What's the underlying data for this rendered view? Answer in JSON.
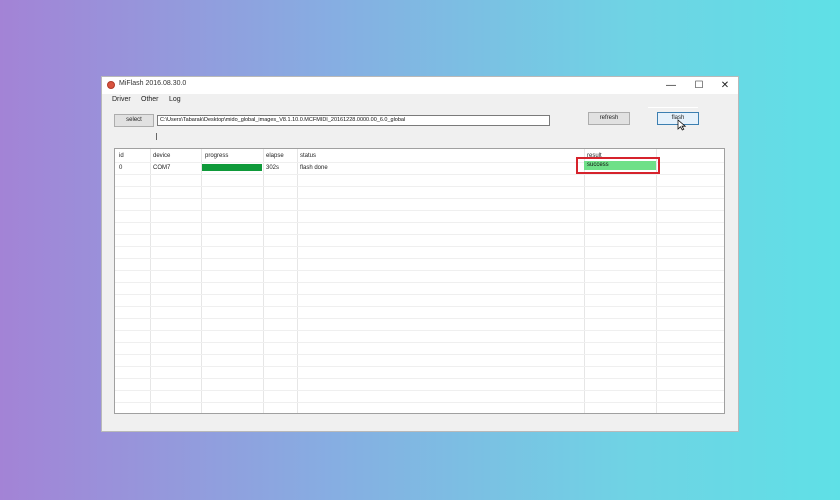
{
  "window": {
    "title": "MiFlash 2016.08.30.0",
    "controls": {
      "minimize": "—",
      "maximize": "☐",
      "close": "✕"
    }
  },
  "menu": {
    "items": [
      "Driver",
      "Other",
      "Log"
    ]
  },
  "toolbar": {
    "select_label": "select",
    "path_value": "C:\\Users\\Tabarak\\Desktop\\mido_global_images_V8.1.10.0.MCFMIDI_20161228.0000.00_6.0_global",
    "refresh_label": "refresh",
    "flash_label": "flash"
  },
  "table": {
    "columns": [
      "id",
      "device",
      "progress",
      "elapse",
      "status",
      "result"
    ],
    "rows": [
      {
        "id": "0",
        "device": "COM7",
        "progress_fraction": 1.0,
        "elapse": "302s",
        "status": "flash done",
        "result": "success"
      }
    ]
  },
  "colors": {
    "progress": "#0f9a3a",
    "result_fill": "#6fe088",
    "highlight_box": "#d6232c"
  }
}
